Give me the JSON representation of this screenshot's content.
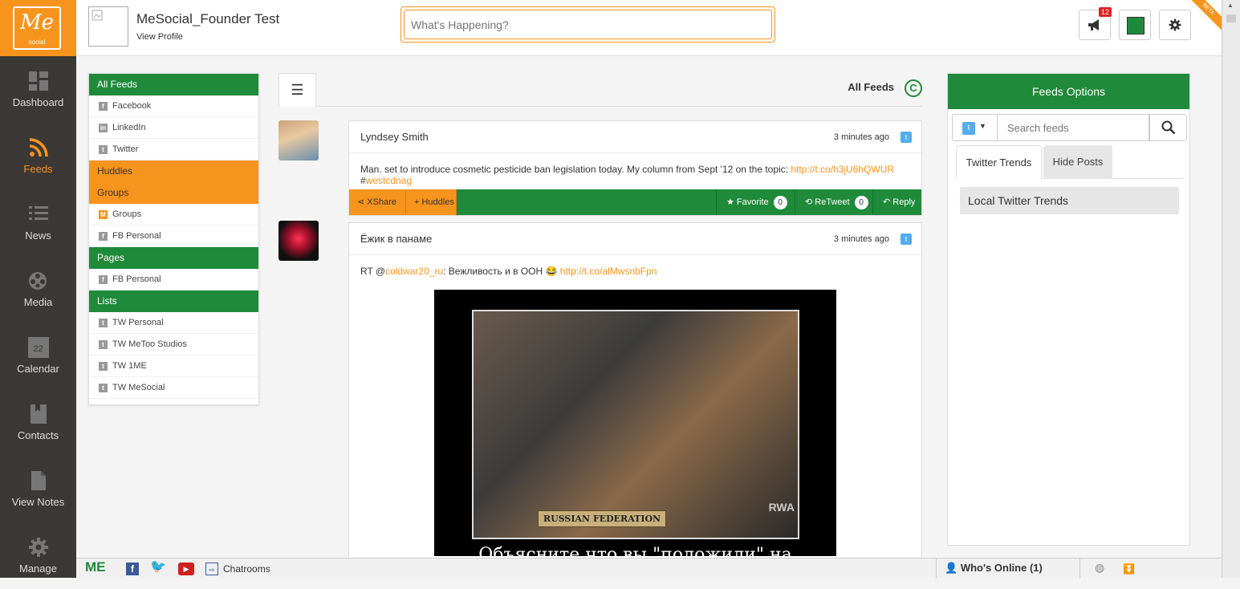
{
  "logo": {
    "mark": "Me",
    "sub": "social"
  },
  "nav": [
    {
      "label": "Dashboard",
      "icon": "dashboard-icon"
    },
    {
      "label": "Feeds",
      "icon": "rss-icon",
      "active": true
    },
    {
      "label": "News",
      "icon": "list-icon"
    },
    {
      "label": "Media",
      "icon": "film-reel-icon"
    },
    {
      "label": "Calendar",
      "icon": "calendar-icon",
      "day": "22"
    },
    {
      "label": "Contacts",
      "icon": "contacts-book-icon"
    },
    {
      "label": "View Notes",
      "icon": "document-icon"
    },
    {
      "label": "Manage",
      "icon": "gear-icon"
    }
  ],
  "header": {
    "user_name": "MeSocial_Founder Test",
    "view_profile": "View Profile",
    "status_placeholder": "What's Happening?",
    "notifications_count": "12",
    "beta": "BETA"
  },
  "feed_list": [
    {
      "kind": "head",
      "color": "green",
      "label": "All Feeds"
    },
    {
      "kind": "item",
      "mark": "f",
      "label": "Facebook"
    },
    {
      "kind": "item",
      "mark": "in",
      "label": "LinkedIn"
    },
    {
      "kind": "item",
      "mark": "t",
      "label": "Twitter"
    },
    {
      "kind": "head",
      "color": "orange",
      "label": "Huddles"
    },
    {
      "kind": "head",
      "color": "orange",
      "label": "Groups"
    },
    {
      "kind": "item",
      "mark": "M",
      "label": "Groups"
    },
    {
      "kind": "item",
      "mark": "f",
      "label": "FB Personal"
    },
    {
      "kind": "head",
      "color": "green",
      "label": "Pages"
    },
    {
      "kind": "item",
      "mark": "f",
      "label": "FB Personal"
    },
    {
      "kind": "head",
      "color": "green",
      "label": "Lists"
    },
    {
      "kind": "item",
      "mark": "t",
      "label": "TW Personal"
    },
    {
      "kind": "item",
      "mark": "t",
      "label": "TW MeToo Studios"
    },
    {
      "kind": "item",
      "mark": "t",
      "label": "TW 1ME"
    },
    {
      "kind": "item",
      "mark": "t",
      "label": "TW MeSocial"
    }
  ],
  "feed_header": {
    "title": "All Feeds",
    "refresh": "C"
  },
  "posts": [
    {
      "author": "Lyndsey Smith",
      "time": "3 minutes ago",
      "text": "Man. set to introduce cosmetic pesticide ban legislation today. My column from Sept '12 on the topic: ",
      "link": "http://t.co/h3jU6hQWUR",
      "hash_prefix": " #",
      "hashtag": "westcdnag",
      "actions": {
        "xshare": "XShare",
        "huddles": "Huddles",
        "favorite": "Favorite",
        "favorite_count": "0",
        "retweet": "ReTweet",
        "retweet_count": "0",
        "reply": "Reply"
      }
    },
    {
      "author": "Ёжик в панаме",
      "time": "3 minutes ago",
      "text_prefix": "RT @",
      "mention": "coldwar20_ru",
      "text_mid": ": Вежливость и в ООН 😂 ",
      "link": "http://t.co/alMwsnbFpn",
      "image_plate": "RUSSIAN FEDERATION",
      "image_sign": "RWA",
      "image_caption": "Объясните что вы \"положили\" на"
    }
  ],
  "options": {
    "title": "Feeds Options",
    "search_placeholder": "Search feeds",
    "tabs": [
      "Twitter Trends",
      "Hide Posts"
    ],
    "local_trends": "Local Twitter Trends"
  },
  "bottom": {
    "me": "ME",
    "chatrooms": "Chatrooms",
    "whos_online": "Who's Online (1)"
  },
  "colors": {
    "orange": "#f7941d",
    "green": "#1f8a3a",
    "sidebar": "#3b3835",
    "twitter": "#55acee"
  }
}
